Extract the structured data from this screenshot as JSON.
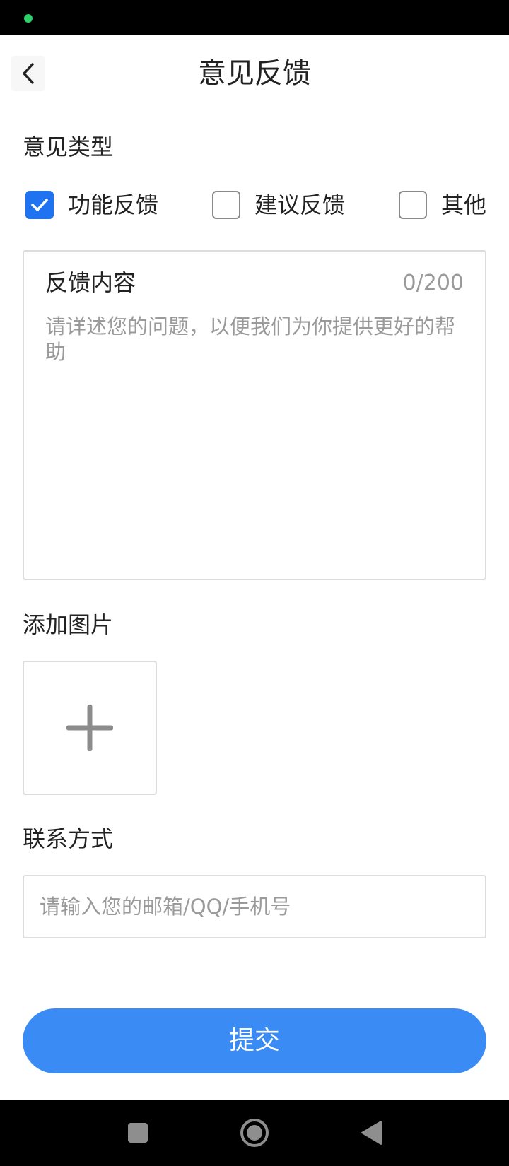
{
  "header": {
    "title": "意见反馈",
    "back_icon": "chevron-left-icon"
  },
  "feedback_type": {
    "label": "意见类型",
    "options": [
      {
        "label": "功能反馈",
        "checked": true
      },
      {
        "label": "建议反馈",
        "checked": false
      },
      {
        "label": "其他",
        "checked": false
      }
    ]
  },
  "feedback_content": {
    "title": "反馈内容",
    "counter": "0/200",
    "value": "",
    "placeholder": "请详述您的问题，以便我们为你提供更好的帮助"
  },
  "add_image": {
    "label": "添加图片",
    "icon": "plus-icon"
  },
  "contact": {
    "label": "联系方式",
    "value": "",
    "placeholder": "请输入您的邮箱/QQ/手机号"
  },
  "submit": {
    "label": "提交"
  },
  "colors": {
    "accent": "#1f73f1",
    "submit_bg": "#3a8bf3",
    "placeholder": "#9a9a9a",
    "border": "#dcdcdc"
  },
  "nav": {
    "icons": [
      "square-icon",
      "home-circle-icon",
      "back-triangle-icon"
    ]
  }
}
